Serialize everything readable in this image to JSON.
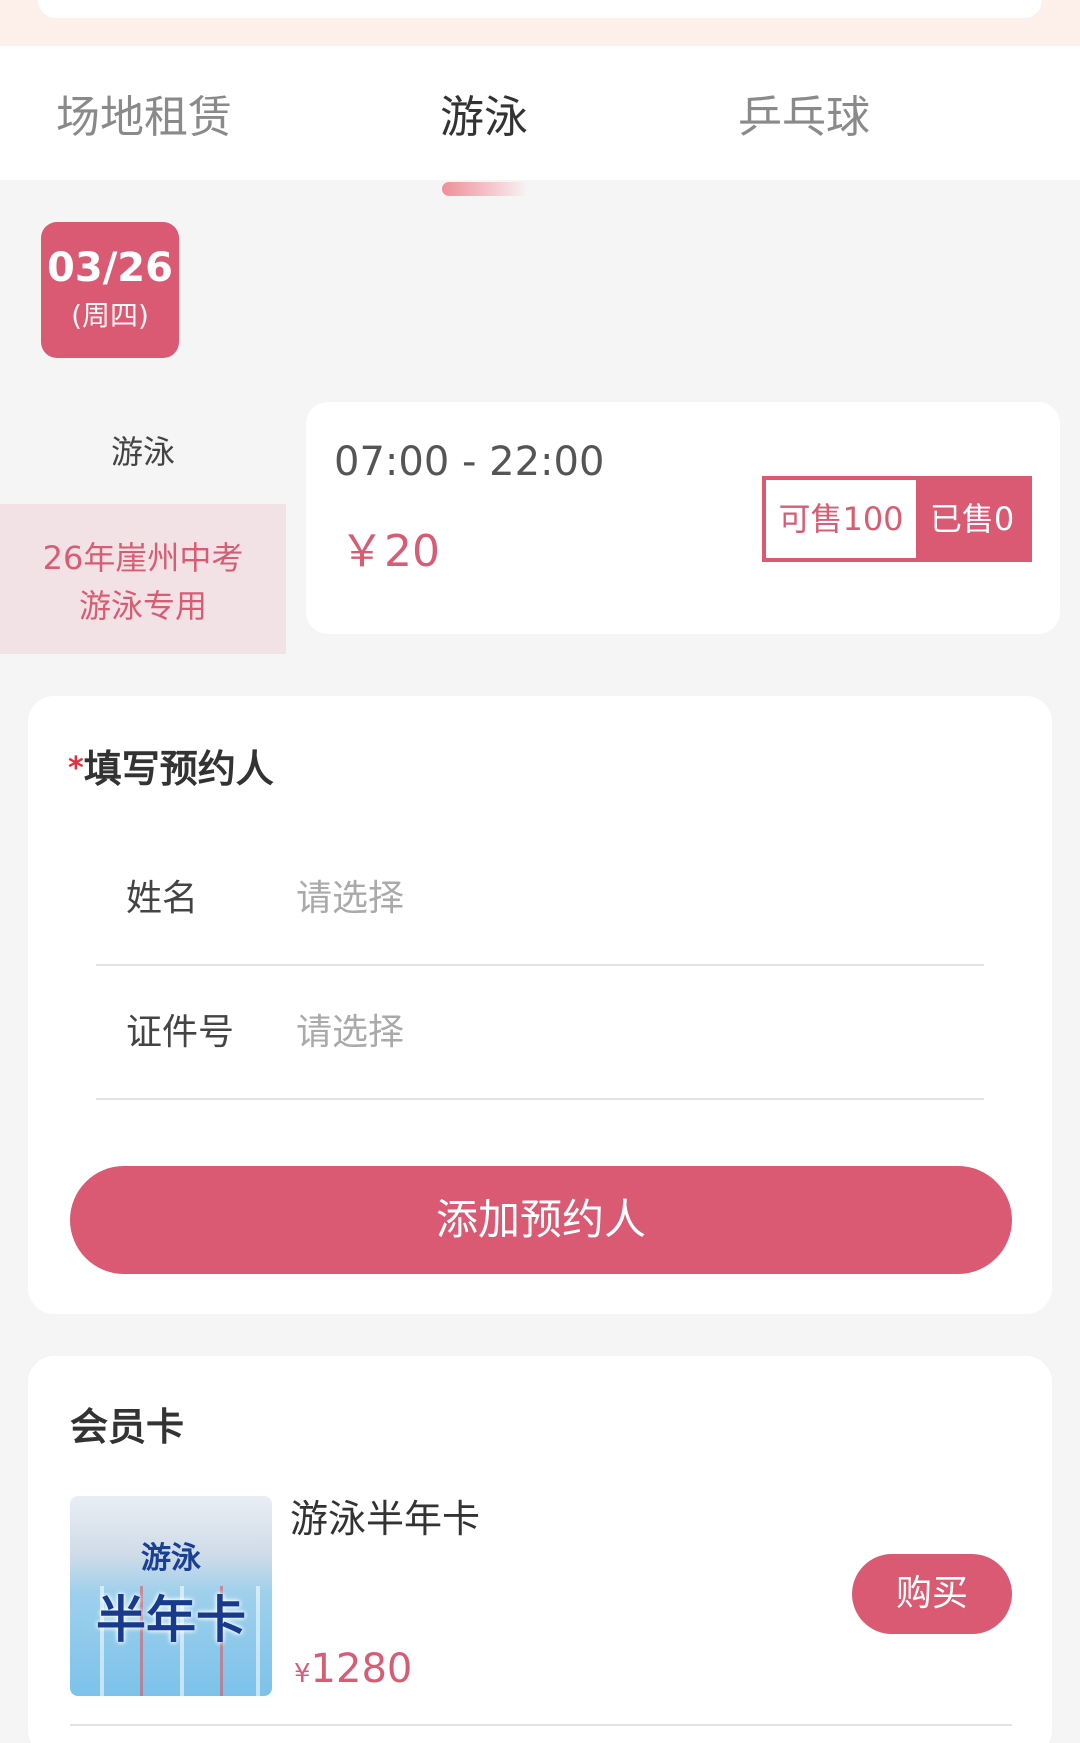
{
  "tabs": [
    {
      "label": "场地租赁",
      "active": false
    },
    {
      "label": "游泳",
      "active": true
    },
    {
      "label": "乒乓球",
      "active": false
    }
  ],
  "date": {
    "day": "03/26",
    "weekday": "(周四)"
  },
  "categories": [
    {
      "label": "游泳",
      "selected": false
    },
    {
      "label_line1": "26年崖州中考",
      "label_line2": "游泳专用",
      "selected": true
    }
  ],
  "session": {
    "time": "07:00 - 22:00",
    "price": "￥20",
    "available": "可售100",
    "sold": "已售0"
  },
  "booking_form": {
    "required_mark": "*",
    "title": "填写预约人",
    "fields": [
      {
        "label": "姓名",
        "placeholder": "请选择"
      },
      {
        "label": "证件号",
        "placeholder": "请选择"
      }
    ],
    "add_button": "添加预约人"
  },
  "membership": {
    "title": "会员卡",
    "cards": [
      {
        "thumb_line1": "游泳",
        "thumb_line2": "半年卡",
        "name": "游泳半年卡",
        "currency": "¥",
        "price": "1280",
        "buy_button": "购买"
      }
    ]
  },
  "colors": {
    "accent": "#d95a72",
    "accent_text": "#d75d74",
    "selected_bg": "#f3e2e5",
    "page_bg": "#f5f5f5"
  }
}
